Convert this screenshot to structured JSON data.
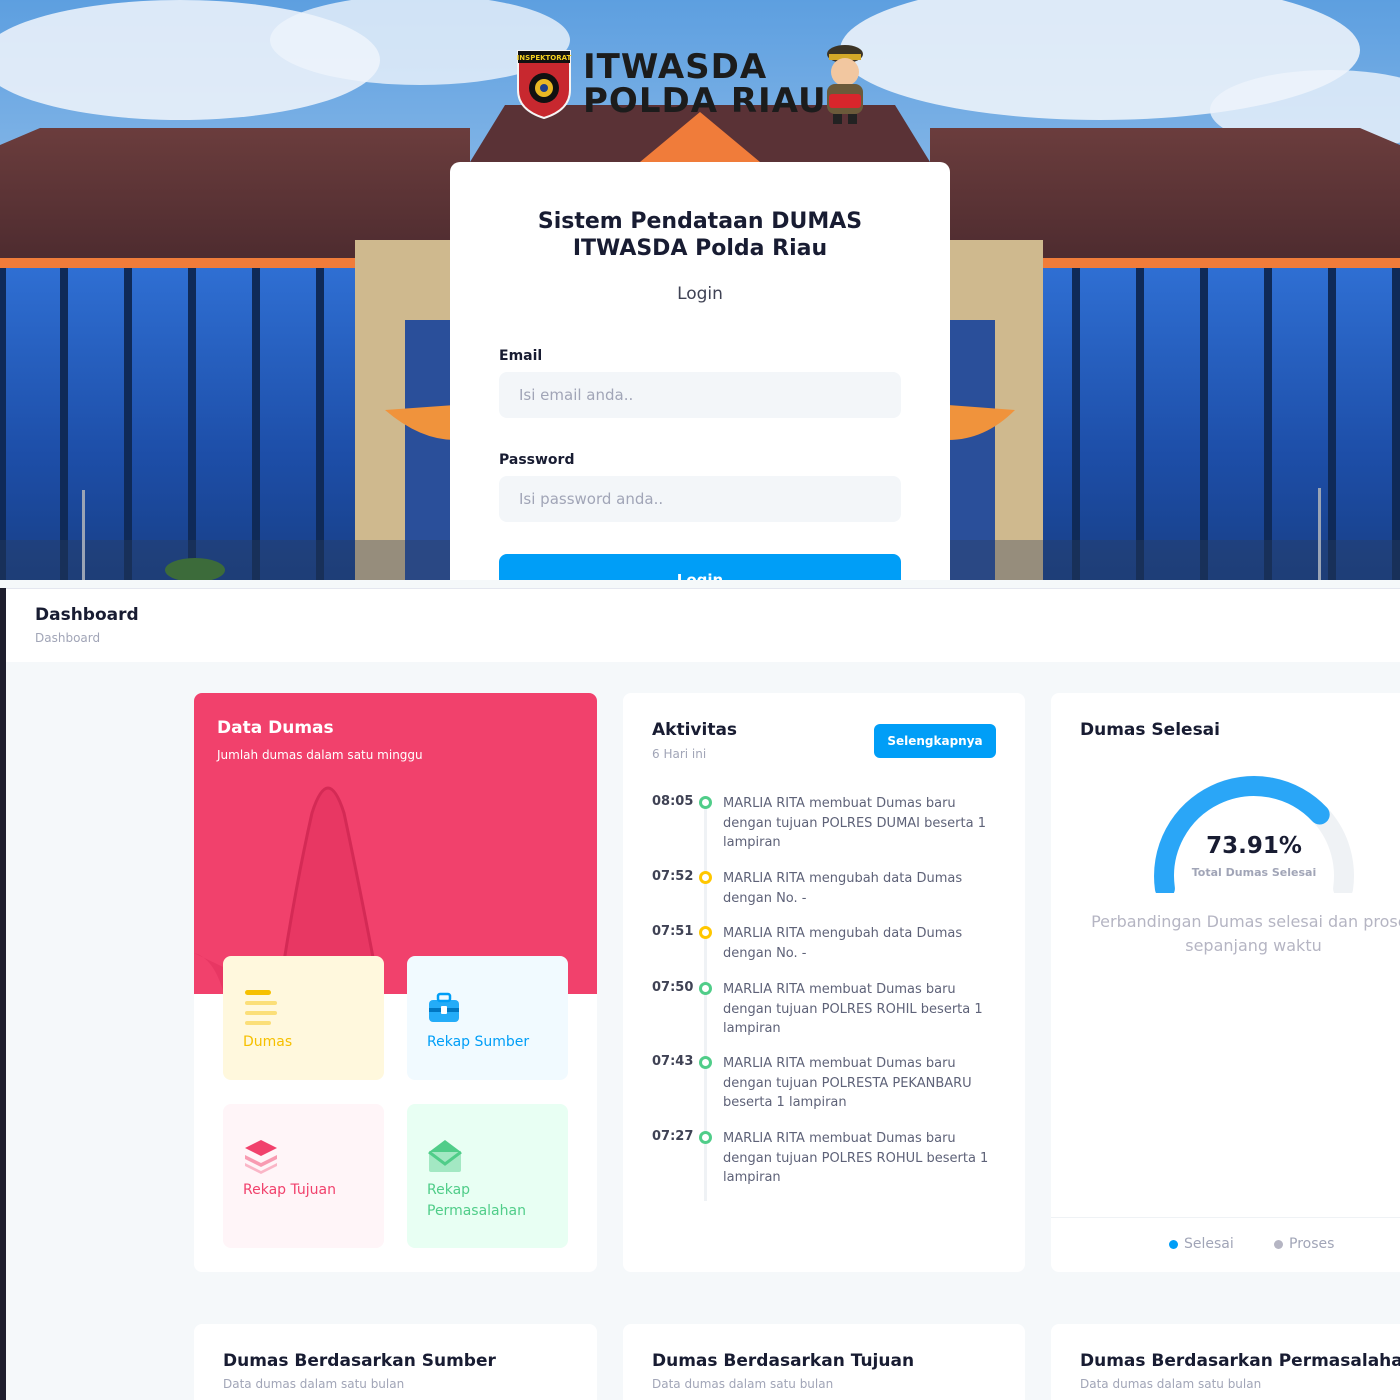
{
  "login": {
    "logo_line1": "ITWASDA",
    "logo_line2": "POLDA RIAU",
    "badge_text": "INSPEKTORAT",
    "title_line1": "Sistem Pendataan DUMAS",
    "title_line2": "ITWASDA Polda Riau",
    "subtitle": "Login",
    "email_label": "Email",
    "email_placeholder": "Isi email anda..",
    "password_label": "Password",
    "password_placeholder": "Isi password anda..",
    "button_label": "Login",
    "accent_color": "#009ef7"
  },
  "dashboard": {
    "header_title": "Dashboard",
    "breadcrumb": "Dashboard",
    "data_dumas": {
      "title": "Data Dumas",
      "subtitle": "Jumlah dumas dalam satu minggu",
      "color": "#f1416c",
      "tiles": [
        {
          "label": "Dumas",
          "icon": "list-icon",
          "color": "#f6c000"
        },
        {
          "label": "Rekap Sumber",
          "icon": "briefcase-icon",
          "color": "#009ef7"
        },
        {
          "label": "Rekap Tujuan",
          "icon": "layers-icon",
          "color": "#f1416c"
        },
        {
          "label": "Rekap Permasalahan",
          "icon": "mail-open-icon",
          "color": "#50cd89"
        }
      ]
    },
    "aktivitas": {
      "title": "Aktivitas",
      "subtitle": "6 Hari ini",
      "button_label": "Selengkapnya",
      "items": [
        {
          "time": "08:05",
          "status": "green",
          "text": "MARLIA RITA membuat Dumas baru dengan tujuan POLRES DUMAI beserta 1 lampiran"
        },
        {
          "time": "07:52",
          "status": "yellow",
          "text": "MARLIA RITA mengubah data Dumas dengan No. -"
        },
        {
          "time": "07:51",
          "status": "yellow",
          "text": "MARLIA RITA mengubah data Dumas dengan No. -"
        },
        {
          "time": "07:50",
          "status": "green",
          "text": "MARLIA RITA membuat Dumas baru dengan tujuan POLRES ROHIL beserta 1 lampiran"
        },
        {
          "time": "07:43",
          "status": "green",
          "text": "MARLIA RITA membuat Dumas baru dengan tujuan POLRESTA PEKANBARU beserta 1 lampiran"
        },
        {
          "time": "07:27",
          "status": "green",
          "text": "MARLIA RITA membuat Dumas baru dengan tujuan POLRES ROHUL beserta 1 lampiran"
        }
      ]
    },
    "dumas_selesai": {
      "title": "Dumas Selesai",
      "value_text": "73.91%",
      "value": 73.91,
      "value_label": "Total Dumas Selesai",
      "description": "Perbandingan Dumas selesai dan proses sepanjang waktu",
      "legend": [
        {
          "label": "Selesai",
          "color": "#009ef7"
        },
        {
          "label": "Proses",
          "color": "#b5b5c3"
        }
      ]
    },
    "bottom_cards": [
      {
        "title": "Dumas Berdasarkan Sumber",
        "subtitle": "Data dumas dalam satu bulan"
      },
      {
        "title": "Dumas Berdasarkan Tujuan",
        "subtitle": "Data dumas dalam satu bulan"
      },
      {
        "title": "Dumas Berdasarkan Permasalahan",
        "subtitle": "Data dumas dalam satu bulan"
      }
    ]
  }
}
